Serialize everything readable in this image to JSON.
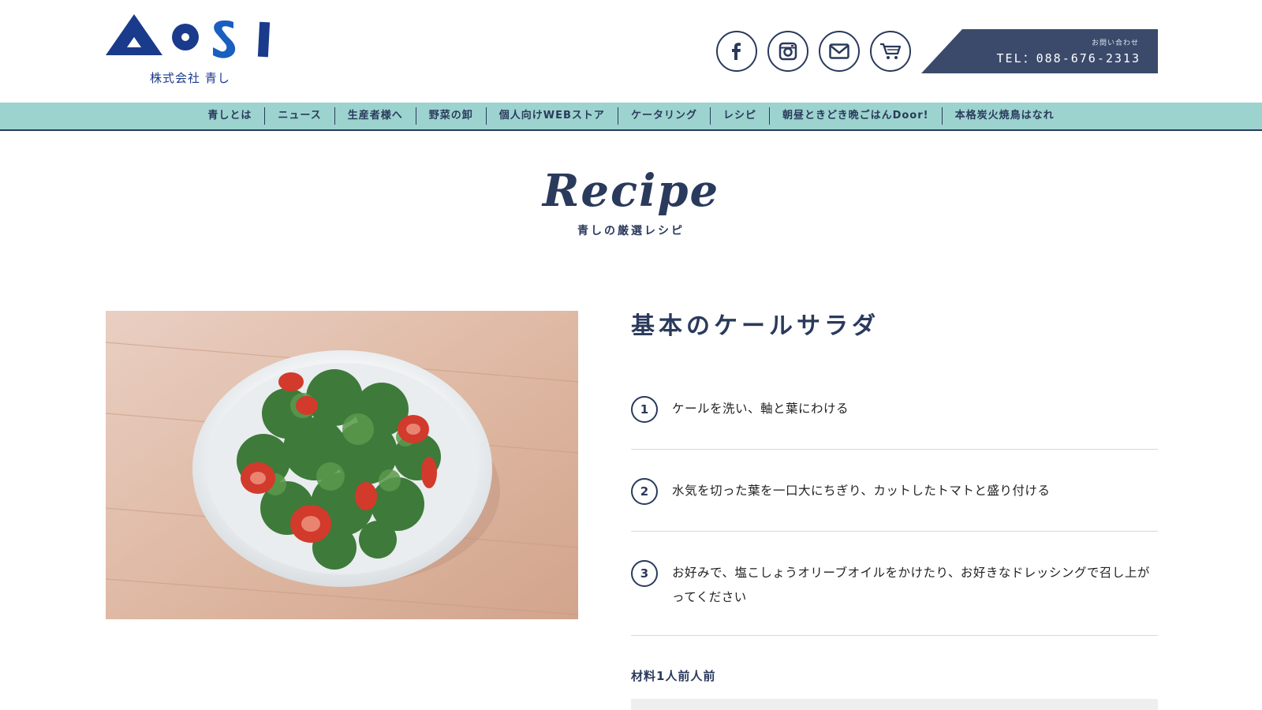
{
  "header": {
    "logo_text": "AOSI",
    "company_name": "株式会社 青し",
    "social": [
      {
        "name": "facebook-icon"
      },
      {
        "name": "instagram-icon"
      },
      {
        "name": "mail-icon"
      },
      {
        "name": "cart-icon"
      }
    ],
    "tel_label": "お問い合わせ",
    "tel_number": "TEL：088-676-2313"
  },
  "nav": {
    "items": [
      "青しとは",
      "ニュース",
      "生産者様へ",
      "野菜の卸",
      "個人向けWEBストア",
      "ケータリング",
      "レシピ",
      "朝昼ときどき晩ごはんDoor!",
      "本格炭火焼鳥はなれ"
    ]
  },
  "page": {
    "heading": "Recipe",
    "subheading": "青しの厳選レシピ"
  },
  "recipe": {
    "title": "基本のケールサラダ",
    "steps": [
      {
        "num": "1",
        "text": "ケールを洗い、軸と葉にわける"
      },
      {
        "num": "2",
        "text": "水気を切った葉を一口大にちぎり、カットしたトマトと盛り付ける"
      },
      {
        "num": "3",
        "text": "お好みで、塩こしょうオリーブオイルをかけたり、お好きなドレッシングで召し上がってください"
      }
    ],
    "ingredients_label": "材料1人前人前"
  },
  "colors": {
    "navy": "#2a3a5c",
    "logo_blue": "#1a3a8c",
    "nav_bg": "#9dd3cf",
    "tel_bg": "#3b4a6b"
  }
}
